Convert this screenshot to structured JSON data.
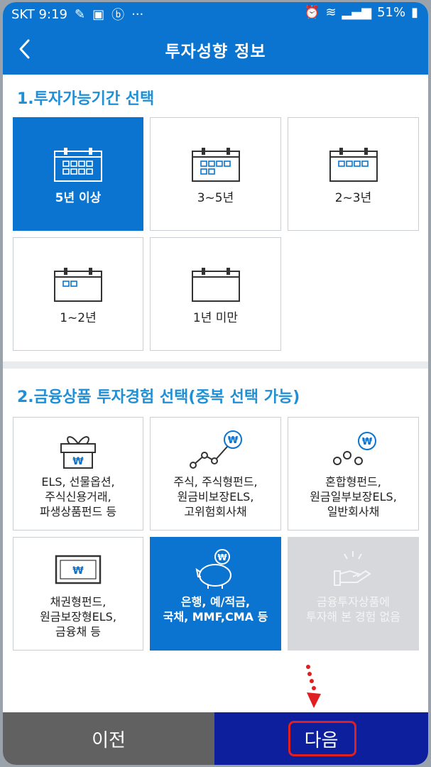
{
  "statusbar": {
    "carrier_time": "SKT 9:19",
    "dots": "···",
    "battery": "51%"
  },
  "appbar": {
    "title": "투자성향 정보"
  },
  "section1": {
    "title": "1.투자가능기간 선택",
    "options": [
      {
        "label": "5년 이상",
        "selected": true
      },
      {
        "label": "3~5년",
        "selected": false
      },
      {
        "label": "2~3년",
        "selected": false
      },
      {
        "label": "1~2년",
        "selected": false
      },
      {
        "label": "1년 미만",
        "selected": false
      }
    ]
  },
  "section2": {
    "title": "2.금융상품 투자경험 선택(중복 선택 가능)",
    "options": [
      {
        "label": "ELS, 선물옵션,\n주식신용거래,\n파생상품펀드 등",
        "icon": "gift-box-won-icon"
      },
      {
        "label": "주식, 주식형펀드,\n원금비보장ELS,\n고위험회사채",
        "icon": "stock-chart-won-icon"
      },
      {
        "label": "혼합형펀드,\n원금일부보장ELS,\n일반회사채",
        "icon": "coins-won-icon"
      },
      {
        "label": "채권형펀드,\n원금보장형ELS,\n금융채 등",
        "icon": "bond-certificate-icon"
      },
      {
        "label": "은행, 예/적금,\n국채, MMF,CMA 등",
        "icon": "piggy-bank-won-icon",
        "selected": true
      },
      {
        "label": "금융투자상품에\n투자해 본 경험 없음",
        "icon": "empty-hand-icon",
        "disabled": true
      }
    ]
  },
  "bottom": {
    "prev_label": "이전",
    "next_label": "다음"
  },
  "colors": {
    "primary": "#0a74d0",
    "next_button": "#0d1f9c",
    "prev_button": "#616161",
    "section_title": "#1f8fd6",
    "annotation": "#e02020"
  }
}
